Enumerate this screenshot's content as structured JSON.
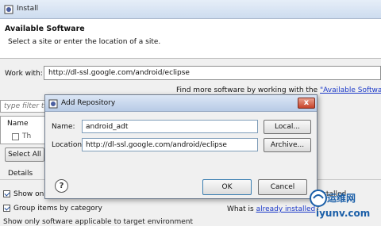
{
  "window": {
    "title": "Install"
  },
  "banner": {
    "heading": "Available Software",
    "subtitle": "Select a site or enter the location of a site."
  },
  "work_with": {
    "label": "Work with:",
    "value": "http://dl-ssl.google.com/android/eclipse"
  },
  "find_more": {
    "text": "Find more software by working with the ",
    "link": "\"Available Software S"
  },
  "filter": {
    "placeholder": "type filter tex"
  },
  "tree": {
    "column": "Name",
    "row_text": "Th"
  },
  "buttons": {
    "select_all": "Select All"
  },
  "details": {
    "label": "Details"
  },
  "options": {
    "show_only": "Show only",
    "group_items": "Group items by category",
    "installed": "installed",
    "what_is": "What is ",
    "already_installed": "already installed",
    "what_is_suffix": "?",
    "cut_off": "Show only software applicable to target environment"
  },
  "dialog": {
    "title": "Add Repository",
    "name_label": "Name:",
    "name_value": "android_adt",
    "location_label": "Location:",
    "location_value": "http://dl-ssl.google.com/android/eclipse",
    "local_button": "Local...",
    "archive_button": "Archive...",
    "ok_button": "OK",
    "cancel_button": "Cancel",
    "close_glyph": "x",
    "help_glyph": "?"
  },
  "watermark": {
    "cn": "运维网",
    "url": "iyunv.com"
  },
  "icons": {
    "window": "eclipse-install-icon",
    "dialog": "eclipse-dialog-icon",
    "help": "help-icon",
    "close": "close-icon"
  },
  "colors": {
    "link": "#1a38c8",
    "title_bar": "#cddcef",
    "close": "#c7432a"
  }
}
